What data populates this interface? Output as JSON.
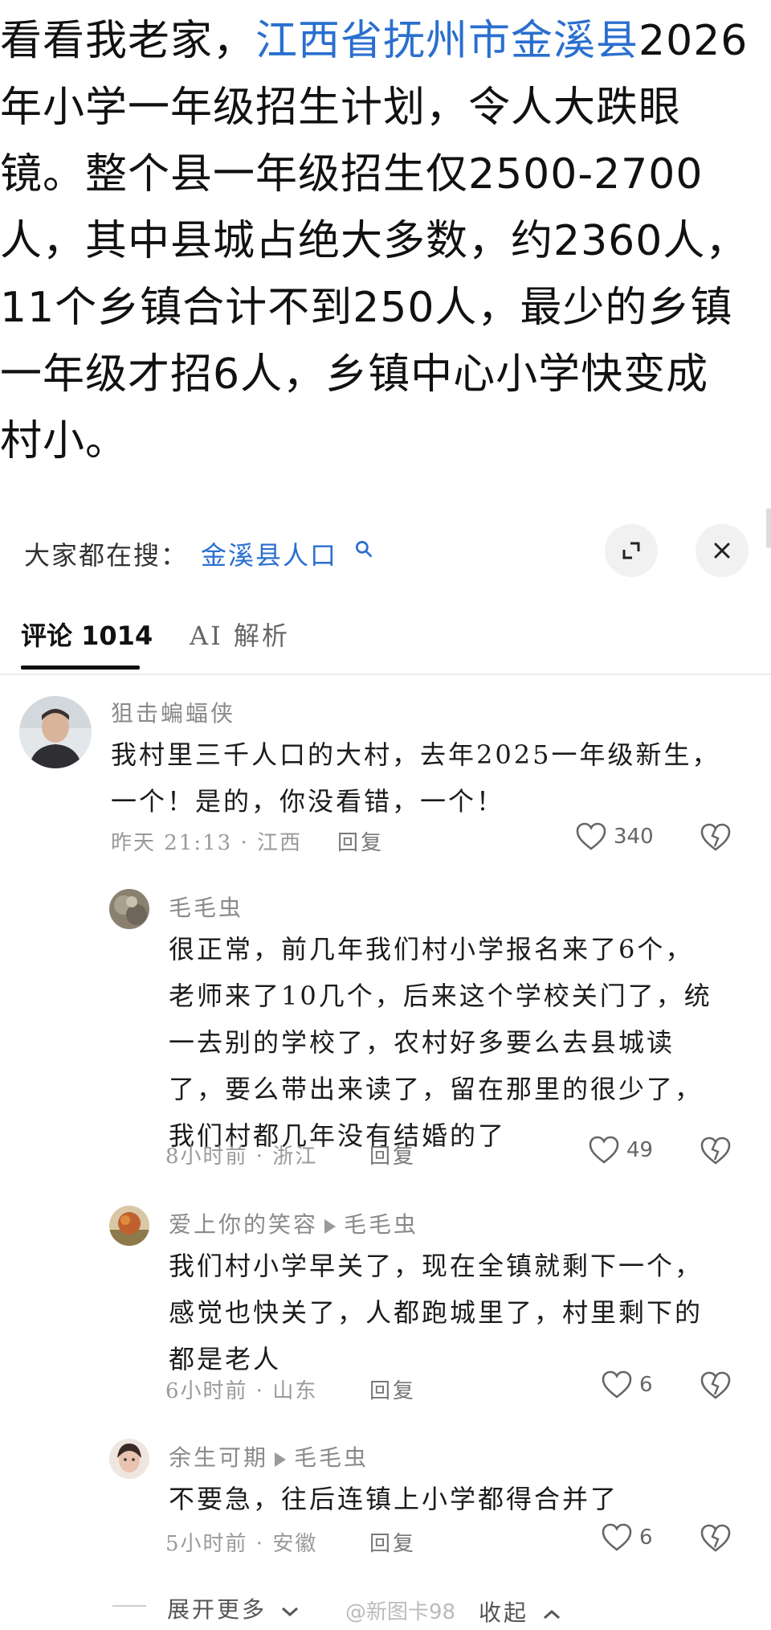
{
  "post": {
    "line1_pre": "看看我老家，",
    "line1_link": "江西省抚州市金溪县",
    "line1_post": "2026",
    "line2": "年小学一年级招生计划，令人大跌眼",
    "line3": "镜。整个县一年级招生仅2500-2700",
    "line4": "人，其中县城占绝大多数，约2360人，",
    "line5": "11个乡镇合计不到250人，最少的乡镇",
    "line6": "一年级才招6人，乡镇中心小学快变成",
    "line7": "村小。"
  },
  "search": {
    "label": "大家都在搜：",
    "term": "金溪县人口"
  },
  "tabs": {
    "comments": "评论 1014",
    "ai": "AI 解析"
  },
  "comments": [
    {
      "name": "狙击蝙蝠侠",
      "lines": [
        "我村里三千人口的大村，去年2025一年级新生，",
        "一个！是的，你没看错，一个！"
      ],
      "time": "昨天 21:13 · 江西",
      "reply": "回复",
      "likes": "340"
    },
    {
      "name": "毛毛虫",
      "lines": [
        "很正常，前几年我们村小学报名来了6个，",
        "老师来了10几个，后来这个学校关门了，统",
        "一去别的学校了，农村好多要么去县城读",
        "了，要么带出来读了，留在那里的很少了，",
        "我们村都几年没有结婚的了"
      ],
      "time": "8小时前 · 浙江",
      "reply": "回复",
      "likes": "49"
    },
    {
      "name": "爱上你的笑容",
      "reply_to": "毛毛虫",
      "lines": [
        "我们村小学早关了，现在全镇就剩下一个，",
        "感觉也快关了，人都跑城里了，村里剩下的",
        "都是老人"
      ],
      "time": "6小时前 · 山东",
      "reply": "回复",
      "likes": "6"
    },
    {
      "name": "余生可期",
      "reply_to": "毛毛虫",
      "lines": [
        "不要急，往后连镇上小学都得合并了"
      ],
      "time": "5小时前 · 安徽",
      "reply": "回复",
      "likes": "6"
    }
  ],
  "footer": {
    "expand": "展开更多",
    "collapse": "收起",
    "watermark": "@新图卡98"
  },
  "colors": {
    "link": "#2a6fcf",
    "text": "#111111",
    "meta": "#9a9a9a"
  },
  "icons": [
    "expand-icon",
    "close-icon",
    "search-icon",
    "heart-icon",
    "broken-heart-icon",
    "chevron-down-icon",
    "chevron-up-icon"
  ]
}
